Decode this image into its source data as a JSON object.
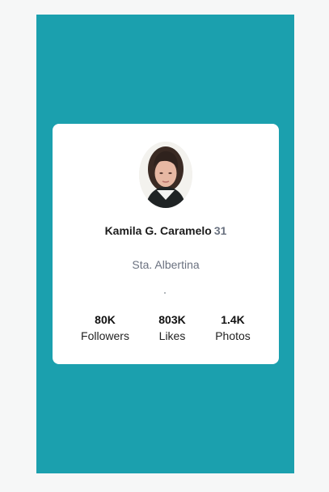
{
  "profile": {
    "name": "Kamila G. Caramelo",
    "age": "31",
    "city": "Sta. Albertina"
  },
  "stats": {
    "followers_value": "80K",
    "followers_label": "Followers",
    "likes_value": "803K",
    "likes_label": "Likes",
    "photos_value": "1.4K",
    "photos_label": "Photos"
  },
  "colors": {
    "page_background": "#f6f7f7",
    "panel_background": "#1ba0ae",
    "card_background": "#ffffff"
  }
}
